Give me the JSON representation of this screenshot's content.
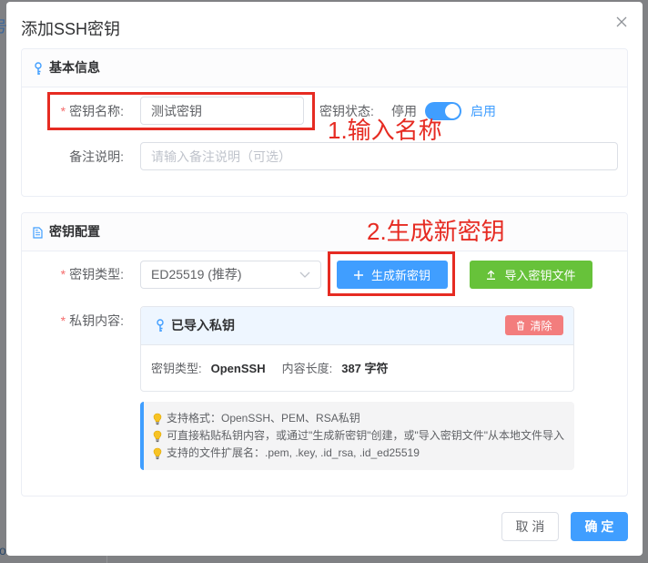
{
  "background": {
    "top_char": "号",
    "bottom_text": "oc"
  },
  "dialog": {
    "title": "添加SSH密钥",
    "close_icon": "close-icon"
  },
  "basic_info": {
    "title": "基本信息",
    "icon": "key-icon",
    "key_name": {
      "required": "*",
      "label": "密钥名称:",
      "value": "测试密钥"
    },
    "key_status": {
      "label": "密钥状态:",
      "off_text": "停用",
      "on_text": "启用",
      "enabled": true
    },
    "remark": {
      "label": "备注说明:",
      "placeholder": "请输入备注说明（可选）",
      "value": ""
    }
  },
  "key_config": {
    "title": "密钥配置",
    "icon": "document-icon",
    "key_type": {
      "required": "*",
      "label": "密钥类型:",
      "selected": "ED25519 (推荐)",
      "icon": "chevron-down-icon"
    },
    "generate_button": {
      "label": "生成新密钥",
      "icon": "plus-icon"
    },
    "import_button": {
      "label": "导入密钥文件",
      "icon": "upload-icon"
    },
    "private_key": {
      "required": "*",
      "label": "私钥内容:",
      "panel_title": "已导入私钥",
      "panel_icon": "key-icon",
      "clear_button": {
        "label": "清除",
        "icon": "trash-icon"
      },
      "type_label": "密钥类型:",
      "type_value": "OpenSSH",
      "length_label": "内容长度:",
      "length_value": "387 字符"
    },
    "tips_icon": "lightbulb-icon",
    "tips": [
      "支持格式：OpenSSH、PEM、RSA私钥",
      "可直接粘贴私钥内容，或通过\"生成新密钥\"创建，或\"导入密钥文件\"从本地文件导入",
      "支持的文件扩展名：.pem, .key, .id_rsa, .id_ed25519"
    ]
  },
  "footer": {
    "cancel": "取 消",
    "confirm": "确 定"
  },
  "annotations": {
    "step1": "1.输入名称",
    "step2": "2.生成新密钥"
  },
  "colors": {
    "accent": "#409eff",
    "success": "#67c23a",
    "danger": "#f37d7d",
    "annotation": "#e62b22",
    "overlay": "#808184"
  }
}
